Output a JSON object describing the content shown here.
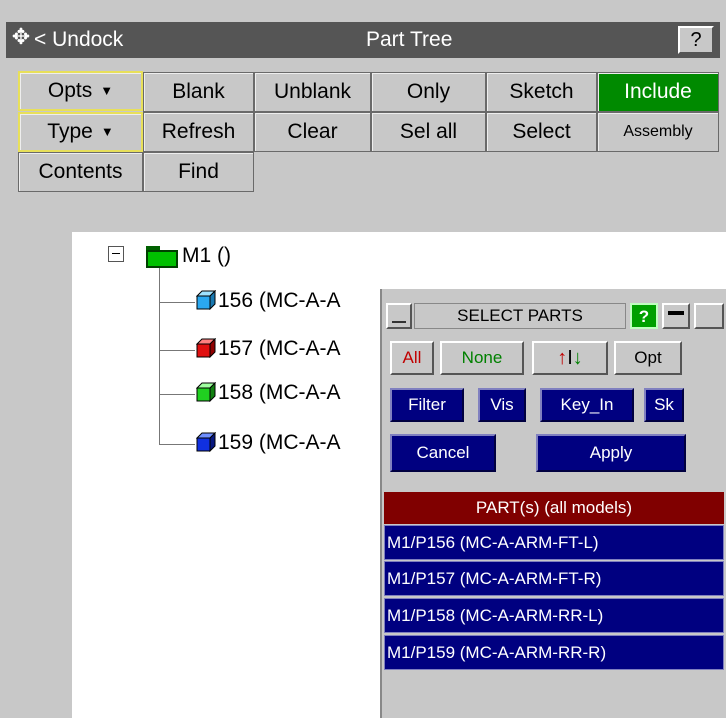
{
  "titlebar": {
    "undock": "< Undock",
    "title": "Part Tree",
    "help": "?"
  },
  "buttons": {
    "opts": "Opts",
    "blank": "Blank",
    "unblank": "Unblank",
    "only": "Only",
    "sketch": "Sketch",
    "include": "Include",
    "type": "Type",
    "refresh": "Refresh",
    "clear": "Clear",
    "sel_all": "Sel all",
    "select": "Select",
    "assembly": "Assembly",
    "contents": "Contents",
    "find": "Find"
  },
  "tree": {
    "root": {
      "label": "M1 ()"
    },
    "items": [
      {
        "label": "156 (MC-A-A",
        "color": "#2aa8f0"
      },
      {
        "label": "157 (MC-A-A",
        "color": "#e01010"
      },
      {
        "label": "158 (MC-A-A",
        "color": "#20d020"
      },
      {
        "label": "159 (MC-A-A",
        "color": "#1030e0"
      }
    ]
  },
  "select_parts": {
    "title": "SELECT PARTS",
    "help": "?",
    "buttons": {
      "all": "All",
      "none": "None",
      "opt": "Opt",
      "filter": "Filter",
      "vis": "Vis",
      "key_in": "Key_In",
      "sk": "Sk",
      "cancel": "Cancel",
      "apply": "Apply"
    },
    "list_header": "PART(s) (all models)",
    "rows": [
      "M1/P156 (MC-A-ARM-FT-L)",
      "M1/P157 (MC-A-ARM-FT-R)",
      "M1/P158 (MC-A-ARM-RR-L)",
      "M1/P159 (MC-A-ARM-RR-R)"
    ]
  },
  "colors": {
    "include_active": "#008a00",
    "list_header": "#800000",
    "list_row": "#000080"
  }
}
